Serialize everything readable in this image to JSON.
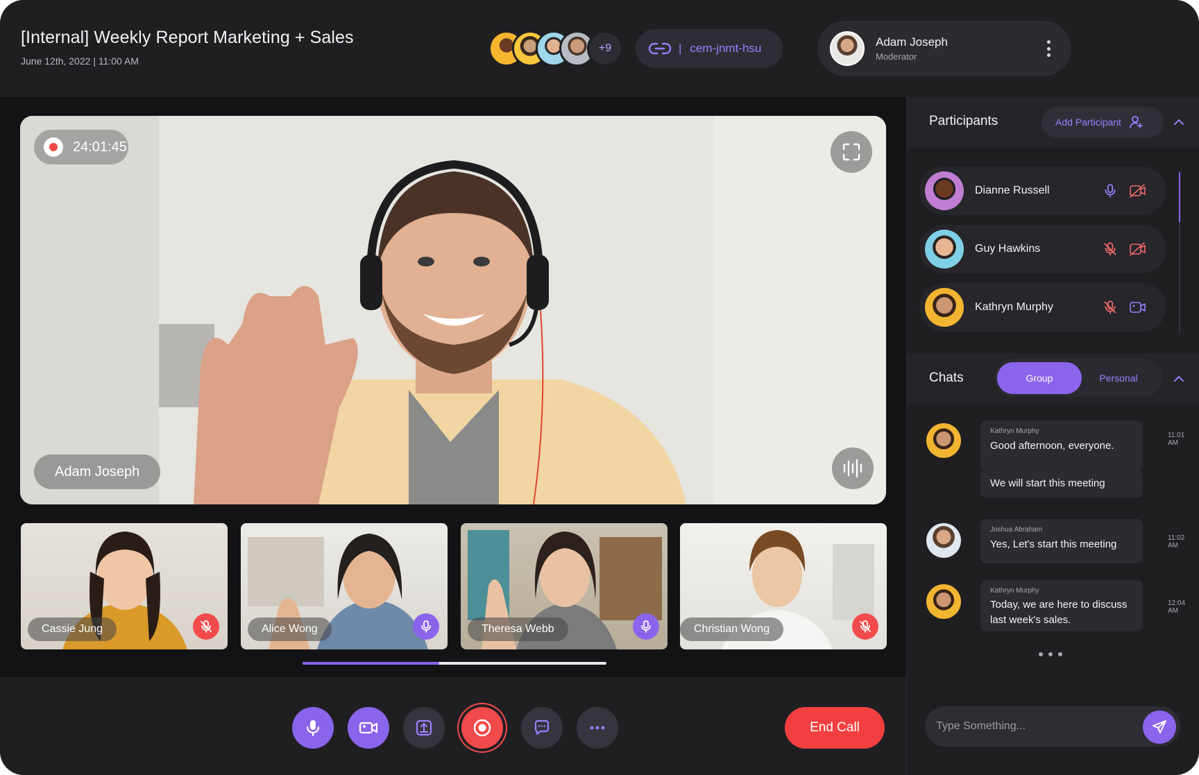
{
  "meeting": {
    "title": "[Internal] Weekly Report Marketing + Sales",
    "datetime": "June 12th, 2022 | 11:00 AM",
    "extra_participants": "+9",
    "link_code": "cem-jnmt-hsu",
    "link_separator": "|"
  },
  "moderator": {
    "name": "Adam Joseph",
    "role": "Moderator"
  },
  "main_video": {
    "recording_time": "24:01:45",
    "speaker_name": "Adam Joseph"
  },
  "thumbnails": [
    {
      "name": "Cassie Jung",
      "mic": "muted"
    },
    {
      "name": "Alice Wong",
      "mic": "on"
    },
    {
      "name": "Theresa Webb",
      "mic": "on"
    },
    {
      "name": "Christian Wong",
      "mic": "muted"
    }
  ],
  "thumbnail_scroll_fraction": 0.45,
  "controls": {
    "icons": [
      "microphone-icon",
      "video-camera-icon",
      "share-screen-icon",
      "record-icon",
      "chat-icon",
      "more-icon"
    ],
    "end_call_label": "End Call"
  },
  "participants_panel": {
    "title": "Participants",
    "add_label": "Add Participant",
    "list": [
      {
        "name": "Dianne Russell",
        "mic": "on",
        "camera": "off"
      },
      {
        "name": "Guy Hawkins",
        "mic": "muted",
        "camera": "off"
      },
      {
        "name": "Kathryn Murphy",
        "mic": "muted",
        "camera": "on"
      }
    ]
  },
  "chats_panel": {
    "title": "Chats",
    "tabs": [
      "Group",
      "Personal"
    ],
    "active_tab": "Group",
    "messages": [
      {
        "sender": "Kathryn Murphy",
        "text": "Good afternoon, everyone.",
        "time": "11:01 AM"
      },
      {
        "sender": "",
        "text": "We will start this meeting",
        "time": ""
      },
      {
        "sender": "Joshua Abraham",
        "text": "Yes, Let's start this meeting",
        "time": "11:02 AM"
      },
      {
        "sender": "Kathryn Murphy",
        "text": "Today, we are here to discuss last week's sales.",
        "time": "12:04 AM"
      }
    ],
    "input_placeholder": "Type Something..."
  },
  "colors": {
    "accent": "#8b64ec",
    "danger": "#f33f3f",
    "background": "#1f1f22",
    "stage": "#131316"
  }
}
